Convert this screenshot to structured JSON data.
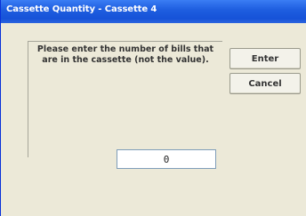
{
  "window": {
    "title": "Cassette Quantity - Cassette 4"
  },
  "prompt": {
    "text": "Please enter the number of bills that are in the cassette (not the value)."
  },
  "buttons": {
    "enter_label": "Enter",
    "cancel_label": "Cancel"
  },
  "input": {
    "value": "0"
  },
  "colors": {
    "titlebar": "#1f5fe0",
    "dialog_background": "#ece9d8",
    "title_text": "#ffffff"
  }
}
